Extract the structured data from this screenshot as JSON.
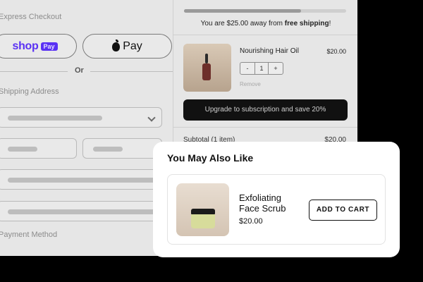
{
  "checkout": {
    "express_label": "Express Checkout",
    "shop_pay": {
      "word": "shop",
      "badge": "Pay",
      "brand_color": "#5a31f4"
    },
    "apple_pay": {
      "label": "Pay",
      "icon": "apple-icon"
    },
    "or_label": "Or",
    "shipping_label": "Shipping Address",
    "payment_label": "Payment Method"
  },
  "cart": {
    "shipping_prefix": "You are $25.00 away from ",
    "shipping_bold": "free shipping",
    "shipping_suffix": "!",
    "shipping_progress": 0.72,
    "item": {
      "name": "Nourishing Hair Oil",
      "price": "$20.00",
      "qty_minus": "-",
      "qty": "1",
      "qty_plus": "+",
      "remove": "Remove"
    },
    "upgrade_label": "Upgrade to subscription and save 20%",
    "subtotal_label": "Subtotal (1 item)",
    "subtotal_value": "$20.00"
  },
  "popup": {
    "title": "You May Also Like",
    "product": {
      "name": "Exfoliating Face Scrub",
      "price": "$20.00",
      "add_label": "ADD TO CART"
    }
  }
}
